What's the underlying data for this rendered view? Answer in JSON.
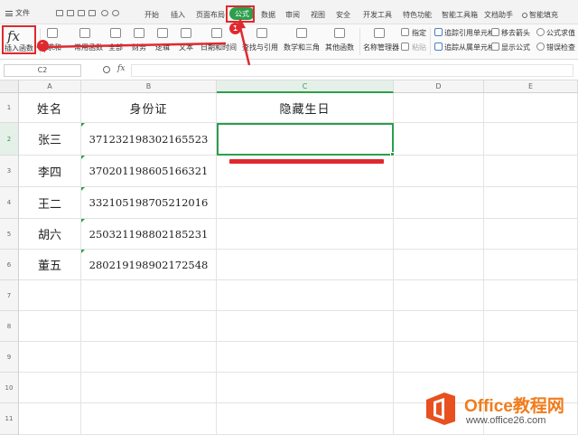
{
  "menu": {
    "file_label": "文件",
    "tabs": [
      "开始",
      "插入",
      "页面布局",
      "公式",
      "数据",
      "审阅",
      "视图",
      "安全",
      "开发工具",
      "特色功能",
      "智能工具箱",
      "文档助手"
    ],
    "active_tab": "公式",
    "search_label": "智能填充"
  },
  "ribbon": {
    "insert_function": "插入函数",
    "fx_symbol": "fx",
    "groups": [
      "求和",
      "常用函数",
      "全部",
      "财务",
      "逻辑",
      "文本",
      "日期和时间",
      "查找与引用",
      "数学和三角",
      "其他函数",
      "名称管理器",
      "指定",
      "粘贴",
      "追踪引用单元格",
      "追踪从属单元格",
      "移去箭头",
      "显示公式",
      "公式求值",
      "错误检查"
    ]
  },
  "formula_bar": {
    "name_box": "C2",
    "fx_symbol": "fx",
    "value": ""
  },
  "sheet": {
    "columns": [
      "A",
      "B",
      "C",
      "D",
      "E"
    ],
    "rows": [
      "1",
      "2",
      "3",
      "4",
      "5",
      "6",
      "7",
      "8",
      "9",
      "10",
      "11"
    ],
    "header": {
      "a": "姓名",
      "b": "身份证",
      "c": "隐藏生日"
    },
    "data": [
      {
        "name": "张三",
        "id": "371232198302165523"
      },
      {
        "name": "李四",
        "id": "370201198605166321"
      },
      {
        "name": "王二",
        "id": "332105198705212016"
      },
      {
        "name": "胡六",
        "id": "250321198802185231"
      },
      {
        "name": "董五",
        "id": "280219198902172548"
      }
    ],
    "selected_cell": "C2"
  },
  "annotations": {
    "step1": "1",
    "step2": "2",
    "accent_color": "#e0292e"
  },
  "watermark": {
    "title": "Office教程网",
    "url": "www.office26.com"
  },
  "colors": {
    "accent_green": "#2d9e4c",
    "annotation_red": "#e0292e",
    "watermark_orange": "#f07c1d"
  }
}
